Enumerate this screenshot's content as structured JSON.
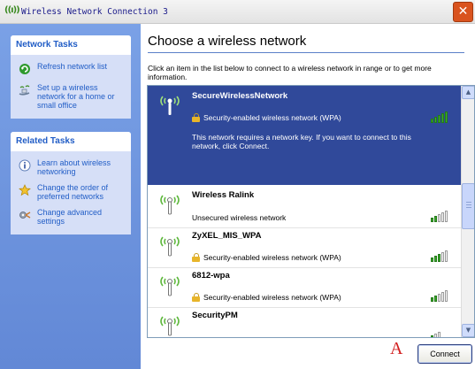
{
  "window": {
    "title": "Wireless Network Connection 3",
    "title_icon": "wifi-antenna-icon",
    "close_icon": "close-icon"
  },
  "network_tasks": {
    "header": "Network Tasks",
    "items": [
      {
        "label": "Refresh network list",
        "icon": "refresh-icon"
      },
      {
        "label": "Set up a wireless network for a home or small office",
        "icon": "setup-wireless-icon"
      }
    ]
  },
  "related_tasks": {
    "header": "Related Tasks",
    "items": [
      {
        "label": "Learn about wireless networking",
        "icon": "info-icon"
      },
      {
        "label": "Change the order of preferred networks",
        "icon": "star-icon"
      },
      {
        "label": "Change advanced settings",
        "icon": "settings-icon"
      }
    ]
  },
  "main": {
    "heading": "Choose a wireless network",
    "intro": "Click an item in the list below to connect to a wireless network in range or to get more information."
  },
  "networks": [
    {
      "ssid": "SecureWirelessNetwork",
      "status": "Security-enabled wireless network (WPA)",
      "secured": true,
      "selected": true,
      "description": "This network requires a network key. If you want to connect to this network, click Connect.",
      "signal_bars": 5
    },
    {
      "ssid": "Wireless Ralink",
      "status": "Unsecured wireless network",
      "secured": false,
      "selected": false,
      "signal_bars": 2
    },
    {
      "ssid": "ZyXEL_MIS_WPA",
      "status": "Security-enabled wireless network (WPA)",
      "secured": true,
      "selected": false,
      "signal_bars": 3
    },
    {
      "ssid": "6812-wpa",
      "status": "Security-enabled wireless network (WPA)",
      "secured": true,
      "selected": false,
      "signal_bars": 2
    },
    {
      "ssid": "SecurityPM",
      "status": "",
      "secured": false,
      "selected": false,
      "signal_bars": 1
    }
  ],
  "annotation": "A",
  "connect_label": "Connect",
  "colors": {
    "selected_bg": "#30499a",
    "task_link": "#215dc6",
    "signal_on": "#3caa2d",
    "annotation_red": "#d21f1f"
  }
}
